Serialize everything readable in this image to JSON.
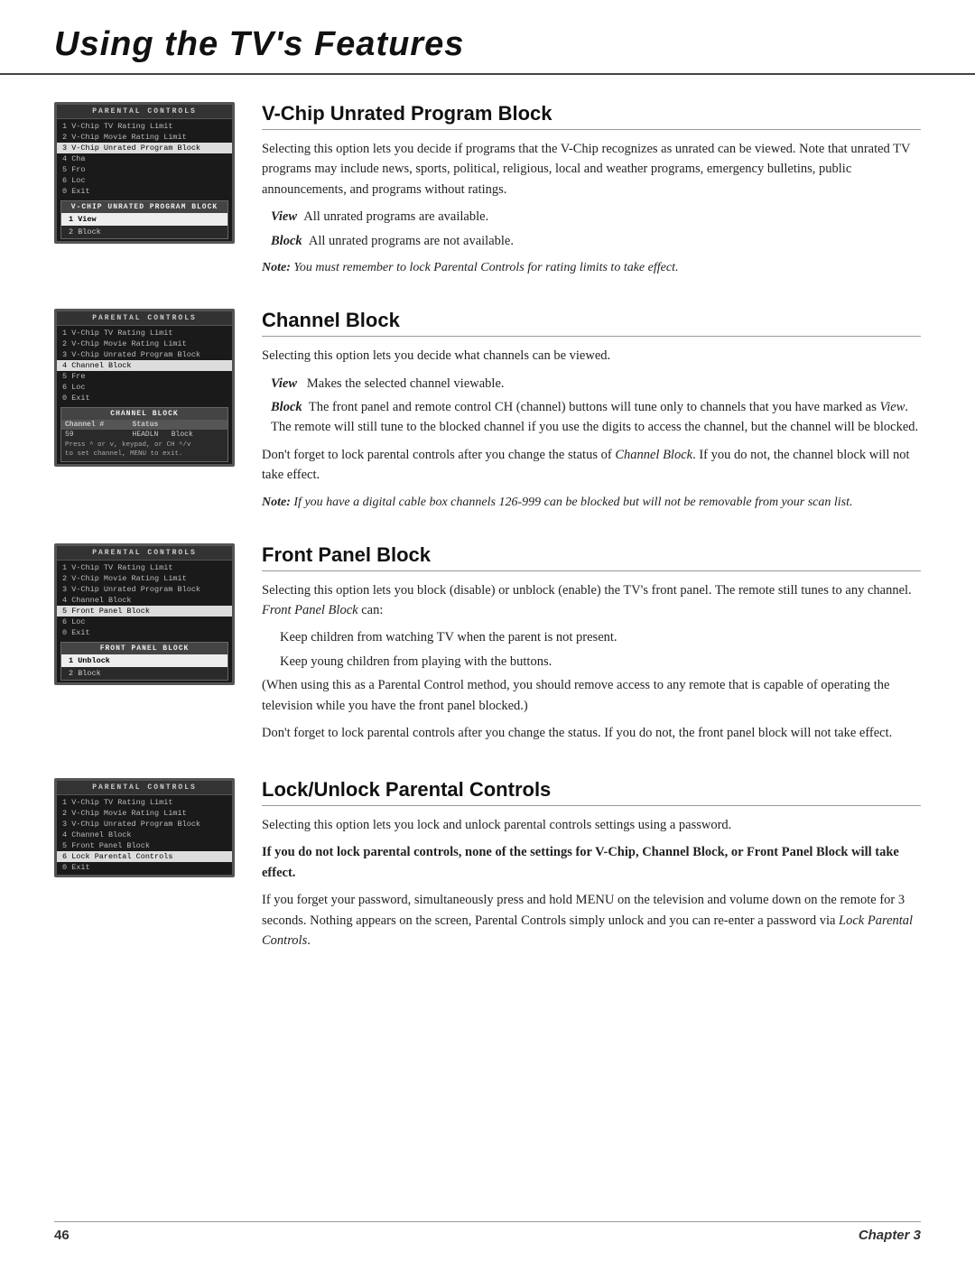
{
  "header": {
    "title": "Using the TV's Features"
  },
  "footer": {
    "page_number": "46",
    "chapter_label": "Chapter 3"
  },
  "sections": [
    {
      "id": "vchip-unrated",
      "heading": "V-Chip Unrated Program Block",
      "tv_header": "PARENTAL CONTROLS",
      "tv_menu_items": [
        "1 V-Chip TV Rating Limit",
        "2 V-Chip Movie Rating Limit",
        "3 V-Chip Unrated Program Block"
      ],
      "tv_menu_selected": "3 V-Chip Unrated Program Block",
      "tv_extra_items": [
        "4 Cha",
        "5 Fro",
        "6 Loc",
        "0 Exit"
      ],
      "tv_submenu_header": "V-CHIP UNRATED PROGRAM BLOCK",
      "tv_submenu_items": [
        {
          "label": "1 View",
          "selected": true
        },
        {
          "label": "2 Block",
          "selected": false
        }
      ],
      "paragraphs": [
        "Selecting this option lets you decide if programs that the V-Chip recognizes as unrated can be viewed. Note that unrated TV programs may include news, sports, political, religious, local and weather programs, emergency bulletins, public announcements, and programs without ratings."
      ],
      "definitions": [
        {
          "term": "View",
          "desc": "All unrated programs are available."
        },
        {
          "term": "Block",
          "desc": "All unrated programs are not available."
        }
      ],
      "note": "Note: You must remember to lock Parental Controls for rating limits to take effect."
    },
    {
      "id": "channel-block",
      "heading": "Channel Block",
      "tv_header": "PARENTAL CONTROLS",
      "tv_menu_items": [
        "1 V-Chip TV Rating Limit",
        "2 V-Chip Movie Rating Limit",
        "3 V-Chip Unrated Program Block",
        "4 Channel Block"
      ],
      "tv_menu_selected": "4 Channel Block",
      "tv_extra_items": [
        "5 Fre",
        "6 Loc",
        "0 Exit"
      ],
      "tv_submenu_header": "CHANNEL BLOCK",
      "tv_submenu_table": {
        "headers": [
          "Channel #",
          "Status"
        ],
        "rows": [
          {
            "ch": "59",
            "status": "HEADLN",
            "status2": "Block"
          }
        ]
      },
      "tv_submenu_note": "Press ^ or v, keypad, or CH ^/v\nto set channel, MENU to exit.",
      "paragraphs": [
        "Selecting this option lets you decide what channels can be viewed."
      ],
      "definitions": [
        {
          "term": "View",
          "desc": "Makes the selected channel viewable."
        },
        {
          "term": "Block",
          "desc": "The front panel and remote control CH (channel) buttons will tune only to channels that you have marked as View. The remote will still tune to the blocked channel if you use the digits to access the channel, but the channel will be blocked."
        }
      ],
      "para2": "Don't forget to lock parental controls after you change the status of Channel Block. If you do not, the channel block will not take effect.",
      "note": "Note: If you have a digital cable box channels 126-999 can be blocked but will not be removable from your scan list."
    },
    {
      "id": "front-panel-block",
      "heading": "Front Panel Block",
      "tv_header": "PARENTAL CONTROLS",
      "tv_menu_items": [
        "1 V-Chip TV Rating Limit",
        "2 V-Chip Movie Rating Limit",
        "3 V-Chip Unrated Program Block",
        "4 Channel Block",
        "5 Front Panel Block"
      ],
      "tv_menu_selected": "5 Front Panel Block",
      "tv_extra_items": [
        "6 Loc",
        "0 Exit"
      ],
      "tv_submenu_header": "FRONT PANEL BLOCK",
      "tv_submenu_items": [
        {
          "label": "1 Unblock",
          "selected": true
        },
        {
          "label": "2 Block",
          "selected": false
        }
      ],
      "paragraphs": [
        "Selecting this option lets you block (disable) or unblock (enable) the TV's front panel. The remote still tunes to any channel. Front Panel Block can:"
      ],
      "bullets": [
        "Keep children from watching TV when the parent is not present.",
        "Keep young children from playing with the buttons."
      ],
      "para2": "(When using this as a Parental Control method, you should remove access to any remote that is capable of operating the television while you have the front panel blocked.)",
      "para3": "Don't forget to lock parental controls after you change the status. If you do not, the front panel block will not take effect."
    },
    {
      "id": "lock-unlock",
      "heading": "Lock/Unlock Parental Controls",
      "tv_header": "PARENTAL CONTROLS",
      "tv_menu_items": [
        "1 V-Chip TV Rating Limit",
        "2 V-Chip Movie Rating Limit",
        "3 V-Chip Unrated Program Block",
        "4 Channel Block",
        "5 Front Panel Block",
        "6 Lock Parental Controls",
        "0 Exit"
      ],
      "tv_menu_selected": "6 Lock Parental Controls",
      "paragraphs": [
        "Selecting this option lets you lock and unlock parental controls settings using a password."
      ],
      "bold_note": "If you do not lock parental controls, none of the settings for V-Chip, Channel Block, or Front Panel Block will take effect.",
      "para2": "If you forget your password, simultaneously press and hold MENU on the television and volume down on the remote for 3 seconds. Nothing appears on the screen, Parental Controls simply unlock and you can re-enter a password via Lock Parental Controls."
    }
  ]
}
